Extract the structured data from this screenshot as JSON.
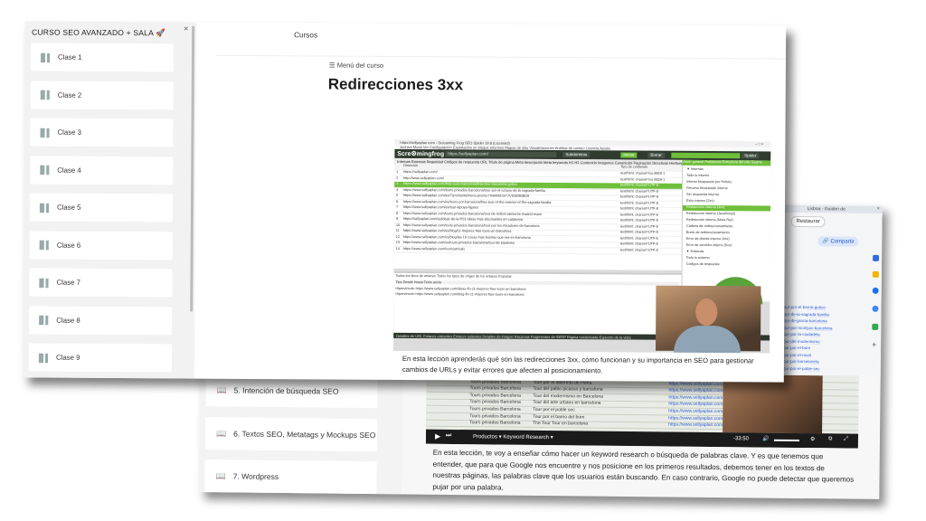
{
  "front": {
    "sidebar_title": "CURSO SEO AVANZADO + SALA 🚀",
    "close_symbol": "×",
    "classes": [
      "Clase 1",
      "Clase 2",
      "Clase 3",
      "Clase 4",
      "Clase 5",
      "Clase 6",
      "Clase 7",
      "Clase 8",
      "Clase 9"
    ],
    "top_link": "Cursos",
    "menu_label": "☰ Menú del curso",
    "lesson_title": "Redirecciones 3xx",
    "description": "En esta lección aprenderás qué son las redirecciones 3xx, cómo funcionan y su importancia en SEO para gestionar cambios de URLs y evitar errores que afecten al posicionamiento.",
    "video": {
      "window_title": "https://sellyaplan.com - Screaming Frog SEO Spider 19.8 (Licensed)",
      "menu_items": "Archivo  Modo  Ver  Configuración  Exportación en bloque  Informes  Mapas de sitio  Visualizaciones  Análisis de rastreo  Licencia  Ayuda",
      "logo": "Scre⚙mingfrog",
      "url": "https://sellyaplan.com/",
      "btn_subdominio": "Subdominio",
      "btn_iniciar": "Iniciar",
      "btn_borrar": "Borrar",
      "btn_spider": "Spider",
      "tabs": "Internas  Externas  Seguridad  Códigos de respuesta  URL  Título de página  Meta descripción  Meta keywords  H1  H2  Contenido  Imágenes  Canonicals  Paginación  Directivas  Hreflang",
      "right_tabs": "Visión general  Problemas  Estructura del sitio  Segme",
      "col_address": "Dirección",
      "col_type": "Tipo de contenido",
      "rows": [
        "https://sellyaplan.com/",
        "http://www.sellyaplan.com/",
        "https://www.sellyaplan.com/free-tours-barcelona/free-tour-barcelona-gotico",
        "https://www.sellyaplan.com/tours-privados-barcelona/tour-por-el-sotano-de-la-sagrada-familia",
        "https://www.sellyaplan.com/es/?q=/cliente/menu-promo-/?rkt48l1hn=7VD5E9BBD9",
        "https://www.sellyaplan.com/es/tours-por-barcelona/free-tour-of-the-exterior-of-the-sagrada-familia",
        "https://www.sellyaplan.com/es/tour-lapuya-figures",
        "https://www.sellyaplan.com/tours-privados-barcelona/tour-de-millors-talmente-madrid-espai",
        "https://sellyaplan.com/es/ideas-de-la-fr/11-ideas-mas-alucinantes-en-catalunya",
        "https://www.sellyaplan.com/tours-privados-barcelona/tour-por-los-miradores-de-barcelona",
        "https://www.sellyaplan.com/es/blog/11-mejores-free-tours-en-barcelona",
        "https://www.sellyaplan.com/es/blog/las-10-cosas-mas-bonitas-que-ver-en-barcelona",
        "https://www.sellyaplan.com/es/tours-privados-barcelona/tour-de-bautismo",
        "https://www.sellyaplan.com/tours/arrivals"
      ],
      "row_types": [
        "text/html; charset=iso-8859-1",
        "text/html; charset=iso-8859-1",
        "text/html; charset=UTF-8",
        "text/html; charset=UTF-8",
        "text/html; charset=UTF-8",
        "text/html; charset=UTF-8",
        "text/html; charset=UTF-8",
        "text/html; charset=UTF-8",
        "text/html; charset=UTF-8",
        "text/html; charset=UTF-8",
        "text/html; charset=UTF-8",
        "text/html; charset=UTF-8",
        "text/html; charset=UTF-8",
        "text/html; charset=UTF-8"
      ],
      "right_rows": [
        "▼ Internas",
        "Todo lo interno",
        "Interno bloqueado por Robots",
        "Recurso bloqueado interno",
        "Sin respuesta interna",
        "Éxito interno (2xx)",
        "Redirección interna (3xx)",
        "Redirección interna (JavaScript)",
        "Redirección interna (Meta Ref)",
        "Cadena de redireccionamiento",
        "Bucle de redireccionamiento",
        "Error de cliente interno (4xx)",
        "Error de servidor interno (5xx)",
        "▼ Externas",
        "Todo lo externo",
        "Códigos de respuesta"
      ],
      "status_bar": "Detalles de URL   Enlaces entrantes   Enlaces salientes   Detalles de imagen   Recursos   Fragmentos de SERP   Página renderizada   Espectro de la vista",
      "bottom_header": "Todos los tipos de enlaces     Todos los tipos de origen de los enlaces     Exportar",
      "bottom_cols": "Tipo       Desde       Hasta       Texto ancla",
      "bottom_rows": [
        "Hipervínculo   https://www.sellyaplan.com/ideas-fin-11-mejores-free-tours-en-barcelona",
        "Hipervínculo   https://www.sellyaplan.com/blog-fin-11-mejores-free-tours-en-barcelona"
      ]
    }
  },
  "back": {
    "items": [
      "5. Intención de búsqueda SEO",
      "6. Textos SEO, Metatags y Mockups SEO",
      "7. Wordpress"
    ],
    "description": "En esta lección, te voy a enseñar cómo hacer un keyword research o búsqueda de palabras clave. Y es que tenemos que entender, que para que Google nos encuentre y nos posicione en los primeros resultados, debemos tener en los textos de nuestras páginas, las palabras clave que los usuarios están buscando. En caso contrario, Google no puede detectar que queremos pujar por una palabra.",
    "sheet_rows": [
      [
        "Tours privados Barcelona",
        "Tour por la catedral",
        "https://www.sellyaplan.com/tours-privados"
      ],
      [
        "Tours privados Barcelona",
        "Tour por el laberinto de Horta",
        "https://www.sellyaplan.com/tours-privados"
      ],
      [
        "Tours privados Barcelona",
        "Tour del pablo picasso y barcelona",
        "https://www.sellyaplan.com/tours-privados"
      ],
      [
        "Tours privados Barcelona",
        "Tour del modernismo en Barcelona",
        "https://www.sellyaplan.com/tours-privados"
      ],
      [
        "Tours privados Barcelona",
        "Tour del arte urbano en barcelona",
        "https://www.sellyaplan.com/tours-privados"
      ],
      [
        "Tours privados Barcelona",
        "Tour por el poble sec",
        "https://www.sellyaplan.com/tours-privados"
      ],
      [
        "Tours privados Barcelona",
        "Tour por el barrio del born",
        "https://www.sellyaplan.com/tours-privados"
      ],
      [
        "Tours privados Barcelona",
        "The Tour Tour en barcelona",
        "https://www.sellyaplan.com/tours-privados"
      ]
    ],
    "video_time": "-33:50",
    "controls_text": "Productos ▾      Keyword Research ▾",
    "chrome_share": "Compartir",
    "chrome_restore": "Restaurar",
    "chrome_tab": "Lisboa - Guiden de",
    "chrome_links": [
      "tour-por-el-barrio-gotico",
      "tour-de-la-sagrada-familia",
      "tour-de-gracia-barcelona",
      "tour-por-montjuic-barcelona",
      "tour-por-la-ciudadela",
      "tour-del-modernismo",
      "tour-por-el-born",
      "tour-por-el-raval",
      "tour-por-barceloneta",
      "tour-por-el-poble-sec"
    ]
  }
}
